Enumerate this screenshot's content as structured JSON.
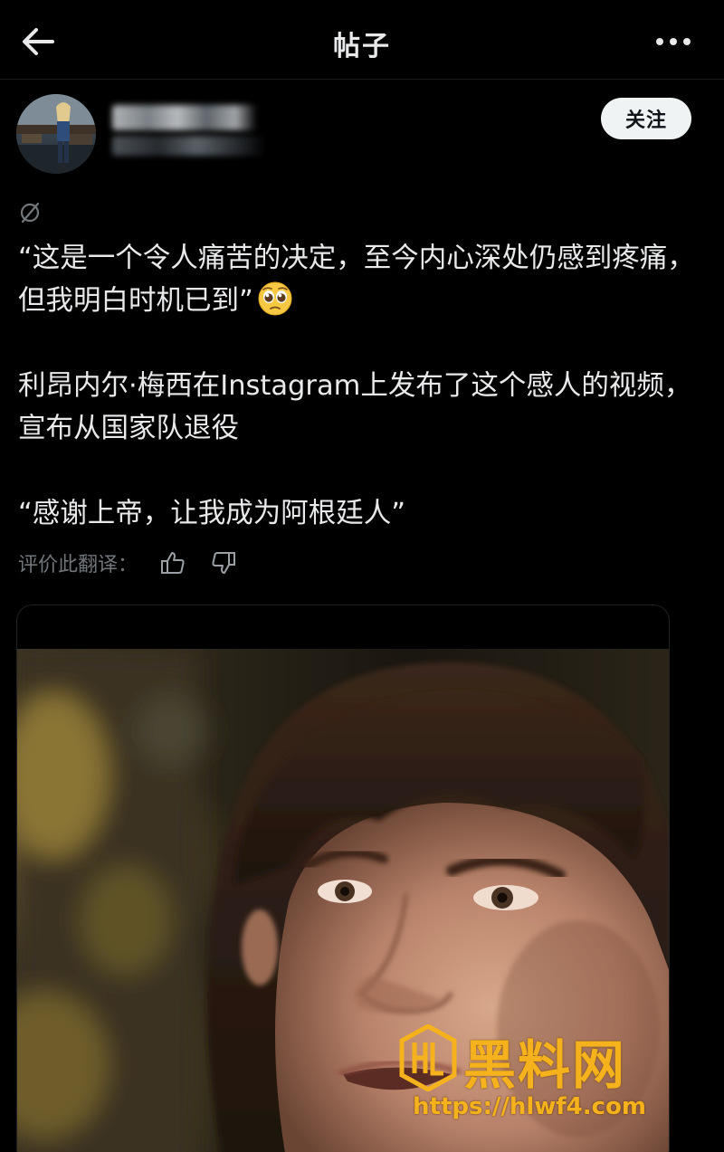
{
  "header": {
    "title": "帖子"
  },
  "author": {
    "follow_label": "关注"
  },
  "post": {
    "paragraph1": "“这是一个令人痛苦的决定，至今内心深处仍感到疼痛，但我明白时机已到”",
    "paragraph2": "利昂内尔·梅西在Instagram上发布了这个感人的视频，宣布从国家队退役",
    "paragraph3": "“感谢上帝，让我成为阿根廷人”",
    "emoji": "pleading-face-emoji"
  },
  "translation": {
    "rate_label": "评价此翻译："
  },
  "watermark": {
    "brand": "黑料网",
    "url": "https://hlwf4.com"
  },
  "icons": {
    "back": "arrow-left-icon",
    "more": "more-horizontal-icon",
    "translate": "translated-icon",
    "thumb_up": "thumb-up-icon",
    "thumb_down": "thumb-down-icon"
  },
  "colors": {
    "background": "#000000",
    "text": "#e7e9ea",
    "muted": "#71767b",
    "follow_bg": "#eff3f4",
    "watermark": "#f5b21c"
  }
}
